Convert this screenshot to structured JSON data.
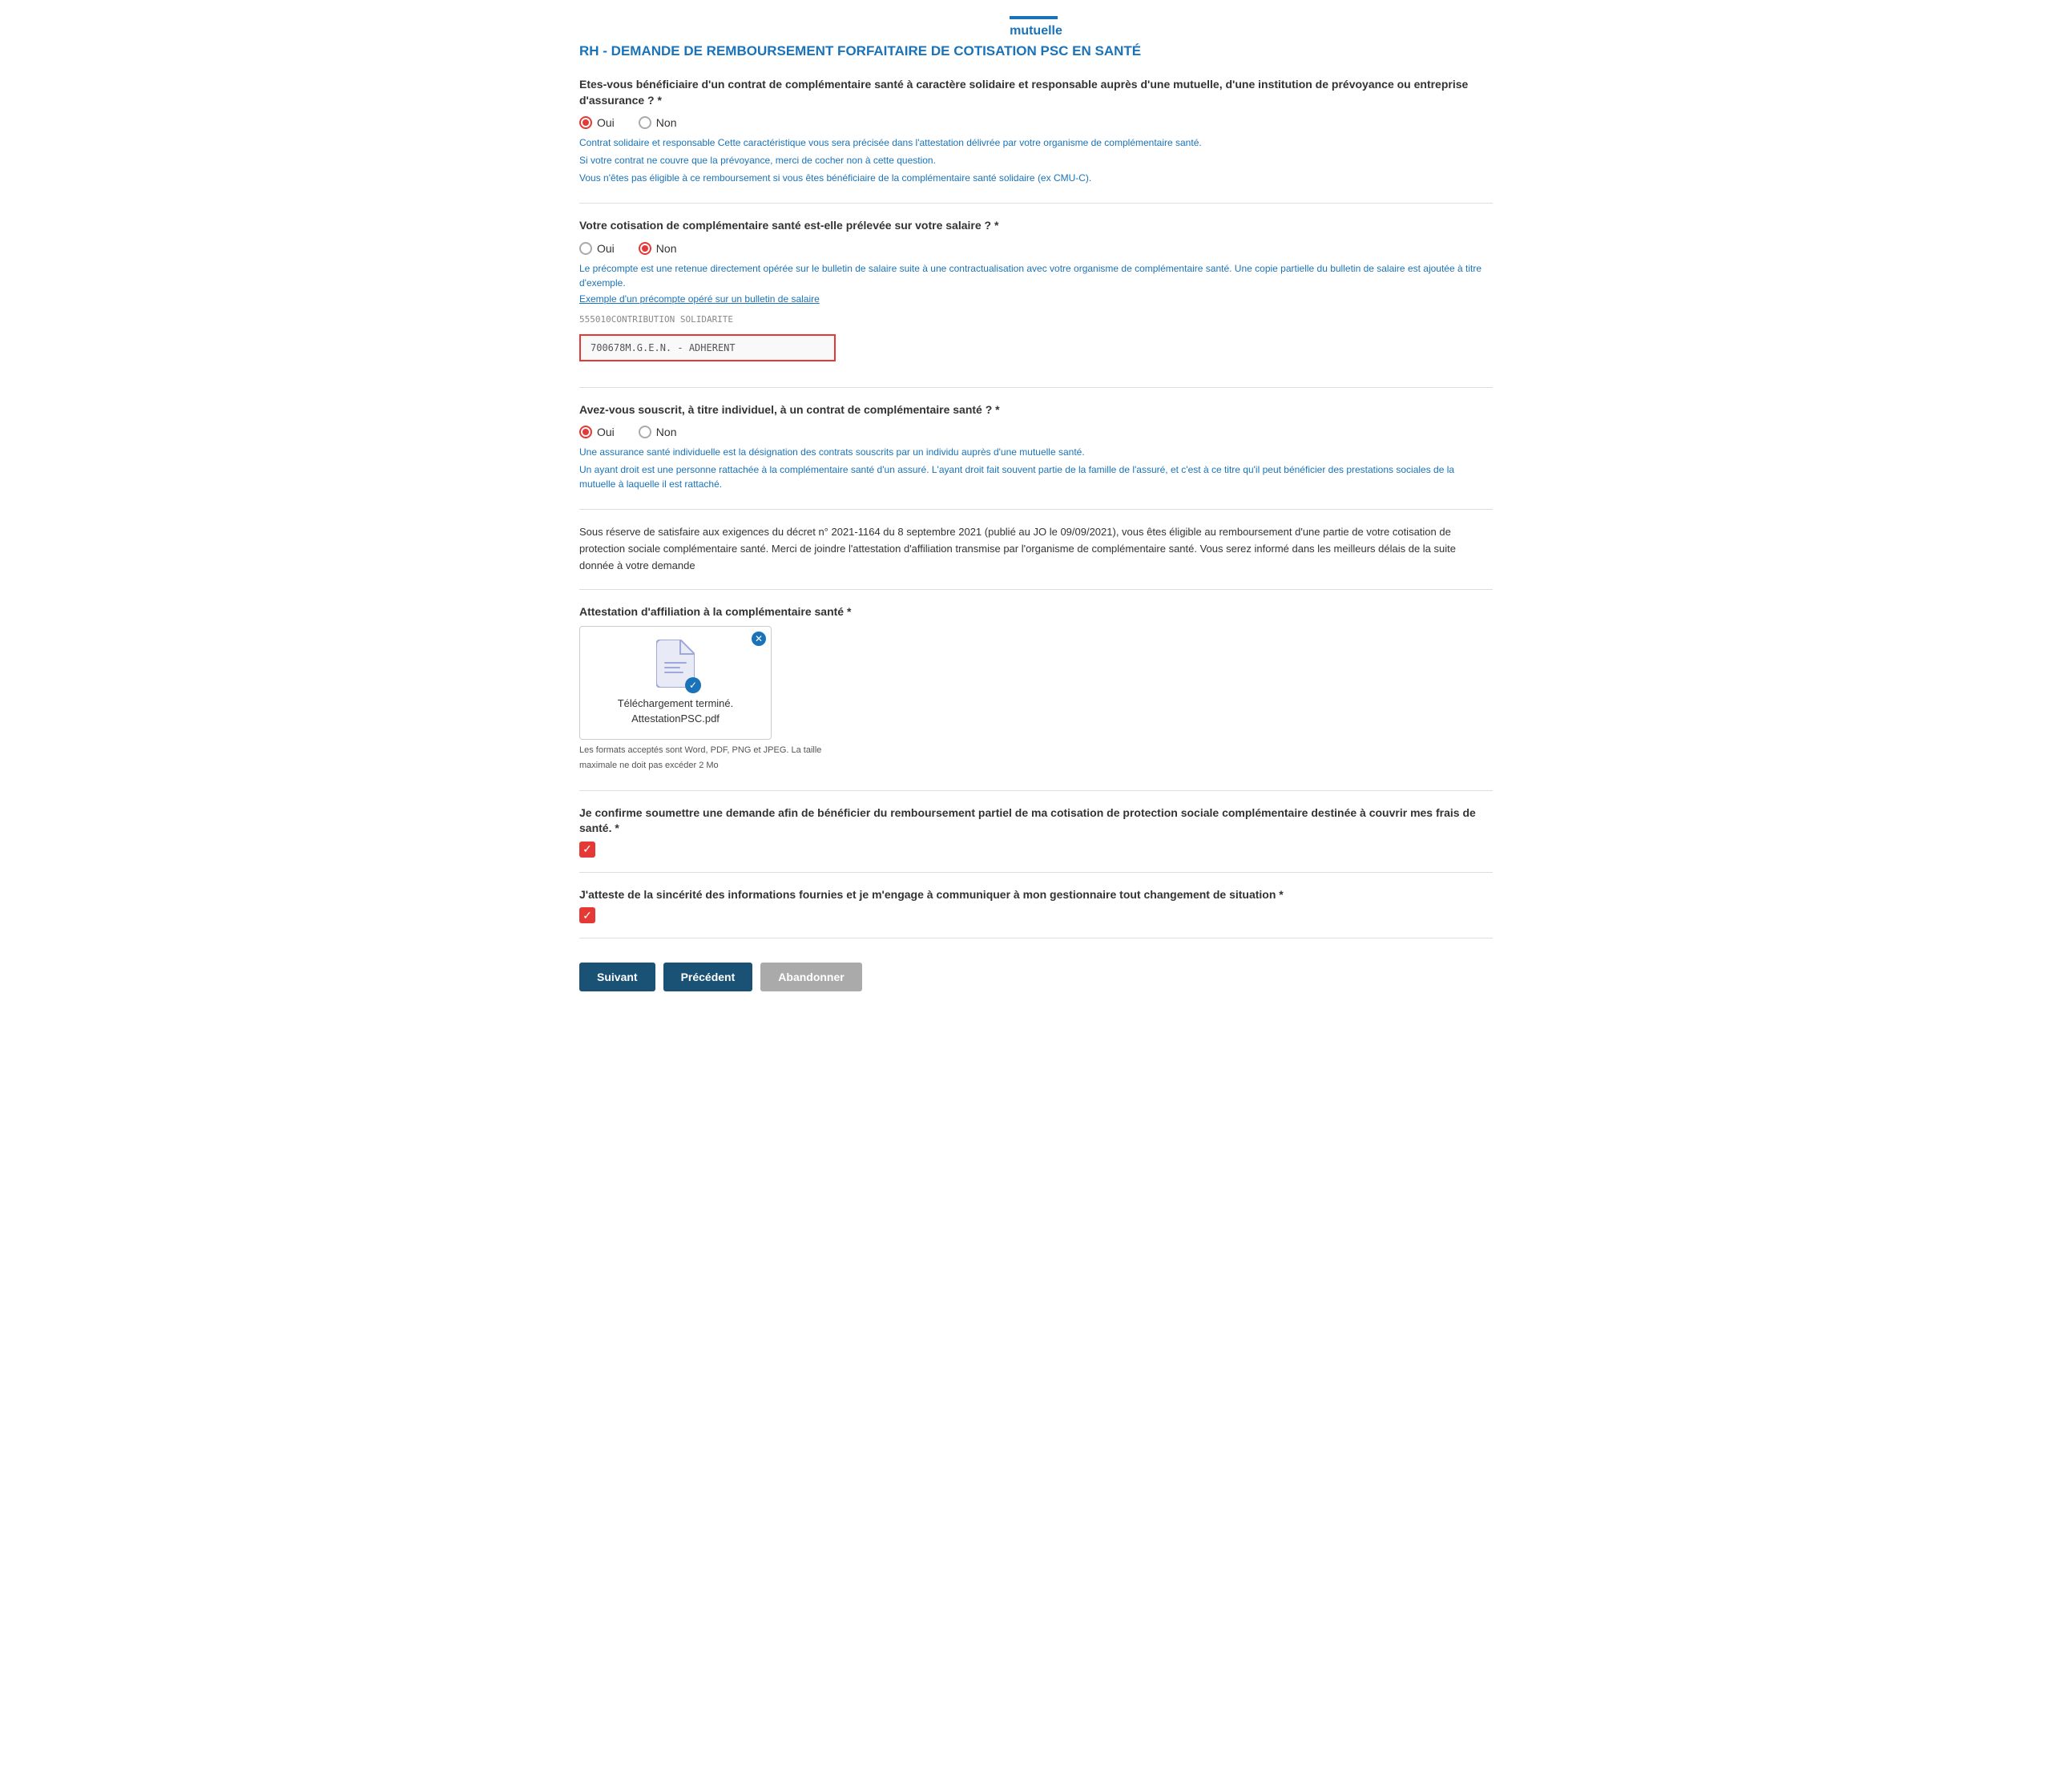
{
  "header": {
    "brand": "mutuelle",
    "page_title": "RH - DEMANDE DE REMBOURSEMENT FORFAITAIRE DE COTISATION PSC EN SANTÉ"
  },
  "questions": {
    "q1": {
      "label": "Etes-vous bénéficiaire d'un contrat de complémentaire santé à caractère solidaire et responsable auprès d'une mutuelle, d'une institution de prévoyance ou entreprise d'assurance ? *",
      "options": [
        "Oui",
        "Non"
      ],
      "selected": "Oui",
      "info_lines": [
        "Contrat solidaire et responsable Cette caractéristique vous sera précisée dans l'attestation délivrée par votre organisme de complémentaire santé.",
        "Si votre contrat ne couvre que la prévoyance, merci de cocher non à cette question.",
        "Vous n'êtes pas éligible à ce remboursement si vous êtes bénéficiaire de la complémentaire santé solidaire (ex CMU-C)."
      ]
    },
    "q2": {
      "label": "Votre cotisation de complémentaire santé est-elle prélevée sur votre salaire ? *",
      "options": [
        "Oui",
        "Non"
      ],
      "selected": "Non",
      "info_lines": [
        "Le précompte est une retenue directement opérée sur le bulletin de salaire suite à une contractualisation avec votre organisme de complémentaire santé. Une copie partielle du bulletin de salaire est ajoutée à titre d'exemple."
      ],
      "info_link": "Exemple d'un précompte opéré sur un bulletin de salaire",
      "salary_lines": [
        {
          "text": "555010CONTRIBUTION SOLIDARITE",
          "strikethrough": true
        },
        {
          "text": "700678M.G.E.N. - ADHERENT",
          "strikethrough": false
        }
      ]
    },
    "q3": {
      "label": "Avez-vous souscrit, à titre individuel, à un contrat de complémentaire santé ? *",
      "options": [
        "Oui",
        "Non"
      ],
      "selected": "Oui",
      "info_lines": [
        "Une assurance santé individuelle est la désignation des contrats souscrits par un individu auprès d'une mutuelle santé.",
        "Un ayant droit est une personne rattachée à la complémentaire santé d'un assuré. L'ayant droit fait souvent partie de la famille de l'assuré, et c'est à ce titre qu'il peut bénéficier des prestations sociales de la mutuelle à laquelle il est rattaché."
      ]
    }
  },
  "eligibility_text": "Sous réserve de satisfaire aux exigences du décret n° 2021-1164 du 8 septembre 2021 (publié au JO le 09/09/2021), vous êtes éligible au remboursement d'une partie de votre cotisation de protection sociale complémentaire santé. Merci de joindre l'attestation d'affiliation transmise par l'organisme de complémentaire santé. Vous serez informé dans les meilleurs délais de la suite donnée à votre demande",
  "upload": {
    "label": "Attestation d'affiliation à la complémentaire santé *",
    "status_line1": "Téléchargement terminé.",
    "status_line2": "AttestationPSC.pdf",
    "hint_line1": "Les formats acceptés sont Word, PDF, PNG et JPEG. La taille",
    "hint_line2": "maximale ne doit pas excéder 2 Mo"
  },
  "confirmations": {
    "c1": {
      "label": "Je confirme soumettre une demande afin de bénéficier du remboursement partiel de ma cotisation de protection sociale complémentaire destinée à couvrir mes frais de santé. *",
      "checked": true
    },
    "c2": {
      "label": "J'atteste de la sincérité des informations fournies et je m'engage à communiquer à mon gestionnaire tout changement de situation *",
      "checked": true
    }
  },
  "buttons": {
    "next": "Suivant",
    "previous": "Précédent",
    "abandon": "Abandonner"
  }
}
